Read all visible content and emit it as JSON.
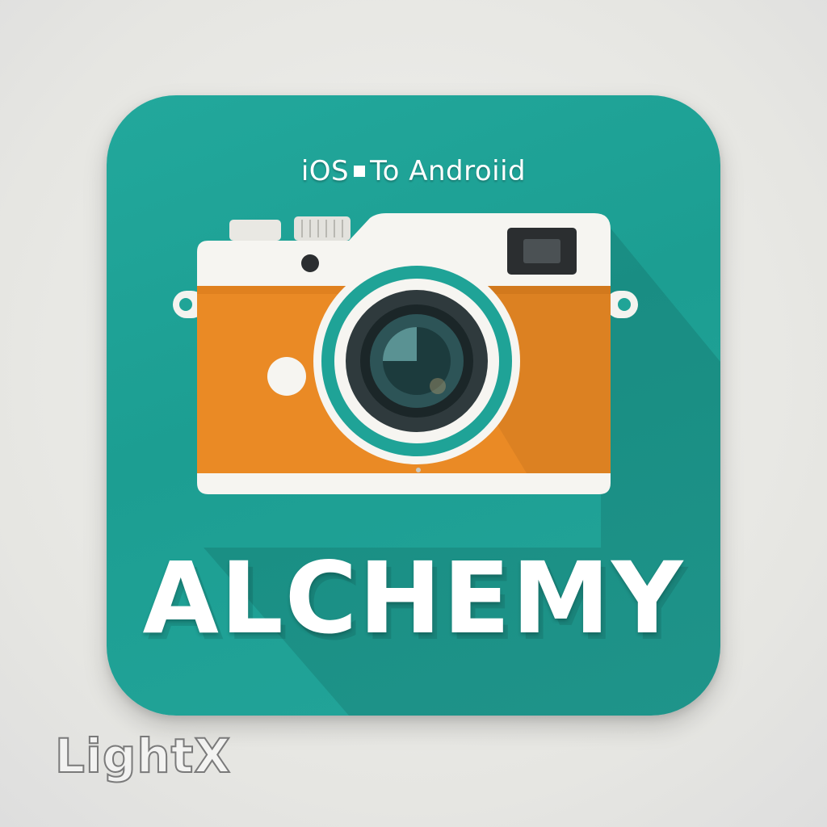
{
  "icon": {
    "subtitle_left": "iOS",
    "subtitle_right": "To Androiid",
    "title": "ALCHEMY",
    "image": "camera-illustration"
  },
  "watermark": {
    "text": "LightX"
  },
  "colors": {
    "background": "#e9e9e6",
    "icon_teal": "#20a497",
    "camera_orange": "#ea8a25",
    "camera_white": "#f6f5f1",
    "lens_dark": "#2f3a3d"
  }
}
